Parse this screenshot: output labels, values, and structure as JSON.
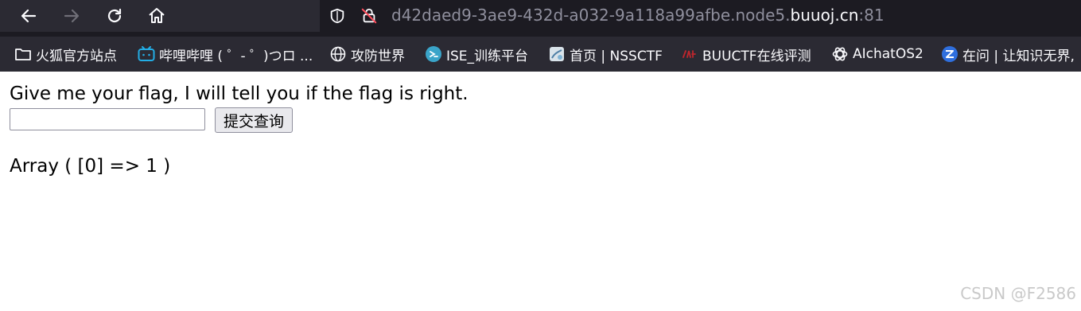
{
  "browser": {
    "url_scheme_part": "d42daed9-3ae9-432d-a032-9a118a99afbe.node5.",
    "url_host": "buuoj.cn",
    "url_port": ":81",
    "bookmarks": [
      {
        "label": "火狐官方站点",
        "icon": "folder-icon"
      },
      {
        "label": "哔哩哔哩 ( ゜- ゜)つロ ...",
        "icon": "bilibili-icon"
      },
      {
        "label": "攻防世界",
        "icon": "globe-icon"
      },
      {
        "label": "ISE_训练平台",
        "icon": "ise-icon"
      },
      {
        "label": "首页 | NSSCTF",
        "icon": "nssctf-icon"
      },
      {
        "label": "BUUCTF在线评测",
        "icon": "buuctf-icon"
      },
      {
        "label": "AIchatOS2",
        "icon": "openai-icon"
      },
      {
        "label": "在问 | 让知识无界,",
        "icon": "zaiwen-icon"
      }
    ]
  },
  "page": {
    "prompt": "Give me your flag, I will tell you if the flag is right.",
    "flag_input_value": "",
    "submit_label": "提交查询",
    "result": "Array ( [0] => 1 )"
  },
  "watermark": "CSDN @F2586",
  "colors": {
    "chrome_dark": "#1c1b22",
    "toolbar": "#2b2a33",
    "url_dim": "#8f8f9d",
    "url_host": "#fbfbfe",
    "buuctf_red": "#c0262d"
  }
}
